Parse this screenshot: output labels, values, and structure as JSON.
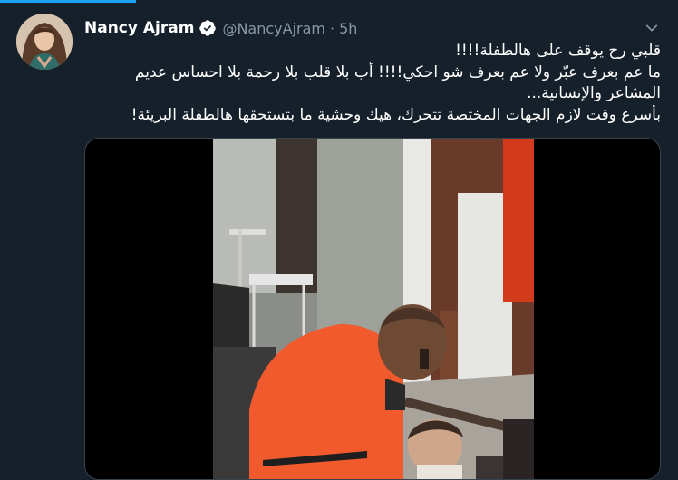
{
  "tweet": {
    "display_name": "Nancy Ajram",
    "handle": "@NancyAjram",
    "separator": "·",
    "time": "5h",
    "lines": [
      "قلبي رح يوقف على هالطفلة!!!!",
      "ما عم بعرف عبّر ولا عم بعرف شو احكي!!!! أب بلا قلب بلا رحمة بلا احساس عديم",
      "المشاعر والإنسانية...",
      "بأسرع وقت لازم الجهات المختصة تتحرك، هيك وحشية ما بتستحقها هالطفلة البريئة!"
    ]
  },
  "icons": {
    "verified": "verified-badge-icon",
    "caret": "chevron-down-icon"
  },
  "colors": {
    "background": "#15202b",
    "accent": "#1da1f2",
    "secondary_text": "#8899a6",
    "border": "#38444d"
  }
}
